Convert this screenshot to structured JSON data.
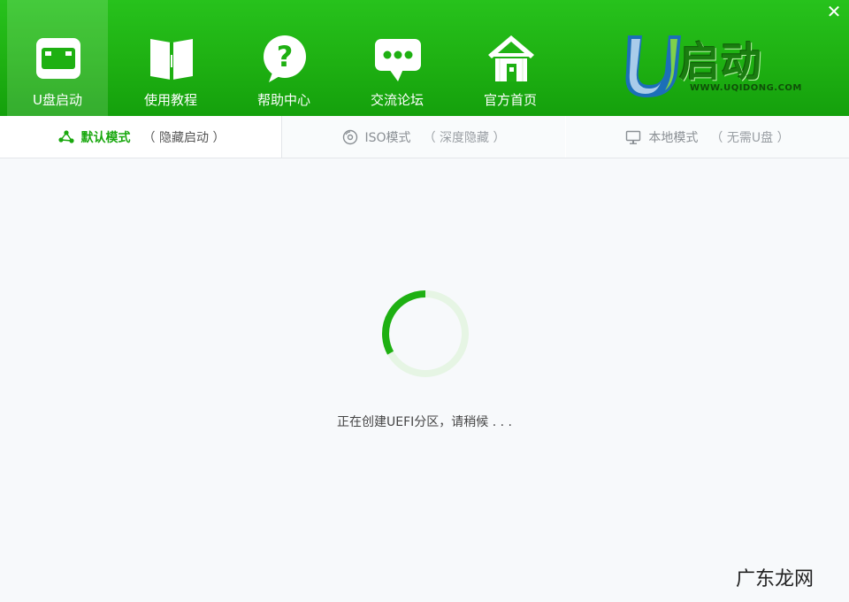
{
  "window": {
    "close_label": "✕"
  },
  "nav": [
    {
      "label": "U盘启动",
      "icon": "usb-drive-icon",
      "active": true
    },
    {
      "label": "使用教程",
      "icon": "book-icon",
      "active": false
    },
    {
      "label": "帮助中心",
      "icon": "help-bubble-icon",
      "active": false
    },
    {
      "label": "交流论坛",
      "icon": "chat-bubble-icon",
      "active": false
    },
    {
      "label": "官方首页",
      "icon": "home-icon",
      "active": false
    }
  ],
  "logo": {
    "text": "启动",
    "letter": "U",
    "url": "WWW.UQIDONG.COM"
  },
  "tabs": [
    {
      "label": "默认模式",
      "sub": "（ 隐藏启动 ）",
      "icon": "share-nodes-icon",
      "active": true
    },
    {
      "label": "ISO模式",
      "sub": "（ 深度隐藏 ）",
      "icon": "disc-icon",
      "active": false
    },
    {
      "label": "本地模式",
      "sub": "（ 无需U盘 ）",
      "icon": "monitor-icon",
      "active": false
    }
  ],
  "status": {
    "message": "正在创建UEFI分区，请稍候 . . .",
    "progress": 0.33
  },
  "watermark": {
    "text": "广东龙网"
  },
  "colors": {
    "header_green": "#1eb012",
    "accent_green": "#1aa80f",
    "spinner_track": "#e6f5e4"
  }
}
